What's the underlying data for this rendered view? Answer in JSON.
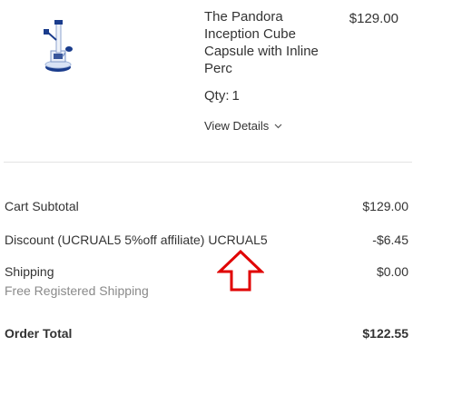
{
  "cart_item": {
    "name": "The Pandora Inception Cube Capsule with Inline Perc",
    "price": "$129.00",
    "qty_label": "Qty:",
    "qty_value": "1",
    "view_details_label": "View Details"
  },
  "totals": {
    "subtotal_label": "Cart Subtotal",
    "subtotal_value": "$129.00",
    "discount_label": "Discount (UCRUAL5 5%off affiliate) UCRUAL5",
    "discount_value": "-$6.45",
    "shipping_label": "Shipping",
    "shipping_method": "Free Registered Shipping",
    "shipping_value": "$0.00",
    "order_total_label": "Order Total",
    "order_total_value": "$122.55"
  },
  "colors": {
    "text": "#333333",
    "muted": "#8a8a8a",
    "divider": "#e3e3e3",
    "annotation": "#e00000",
    "product_blue": "#1a3c8c"
  },
  "icons": {
    "view_details": "chevron-down-icon",
    "annotation": "arrow-up-icon"
  }
}
